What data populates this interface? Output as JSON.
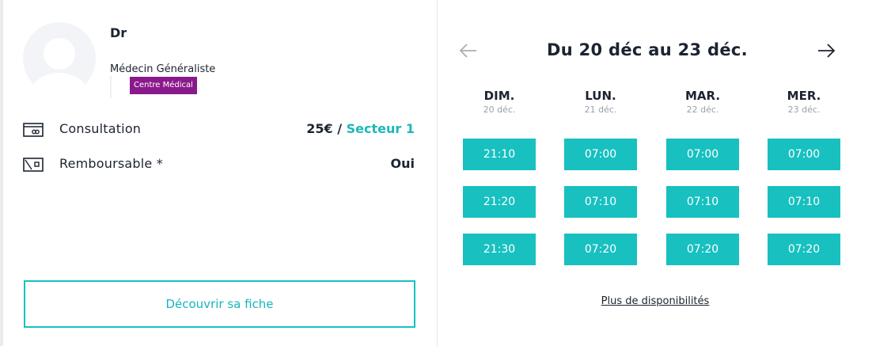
{
  "doctor": {
    "title": "Dr",
    "specialty": "Médecin Généraliste",
    "badge": "Centre Médical"
  },
  "info": {
    "consultation_label": "Consultation",
    "consultation_price": "25€ / ",
    "consultation_sector": "Secteur 1",
    "refund_label": "Remboursable *",
    "refund_value": "Oui"
  },
  "discover_label": "Découvrir sa fiche",
  "calendar": {
    "range": "Du 20 déc au 23 déc.",
    "days": [
      {
        "day": "DIM.",
        "date": "20 déc.",
        "slots": [
          "21:10",
          "21:20",
          "21:30"
        ]
      },
      {
        "day": "LUN.",
        "date": "21 déc.",
        "slots": [
          "07:00",
          "07:10",
          "07:20"
        ]
      },
      {
        "day": "MAR.",
        "date": "22 déc.",
        "slots": [
          "07:00",
          "07:10",
          "07:20"
        ]
      },
      {
        "day": "MER.",
        "date": "23 déc.",
        "slots": [
          "07:00",
          "07:10",
          "07:20"
        ]
      }
    ],
    "more_label": "Plus de disponibilités"
  },
  "colors": {
    "accent": "#18c0c0",
    "badge": "#8a1a8c",
    "text": "#1c2331"
  },
  "icons": {
    "prev": "arrow-left-icon",
    "next": "arrow-right-icon",
    "consultation": "card-icon",
    "refund": "refund-icon"
  }
}
